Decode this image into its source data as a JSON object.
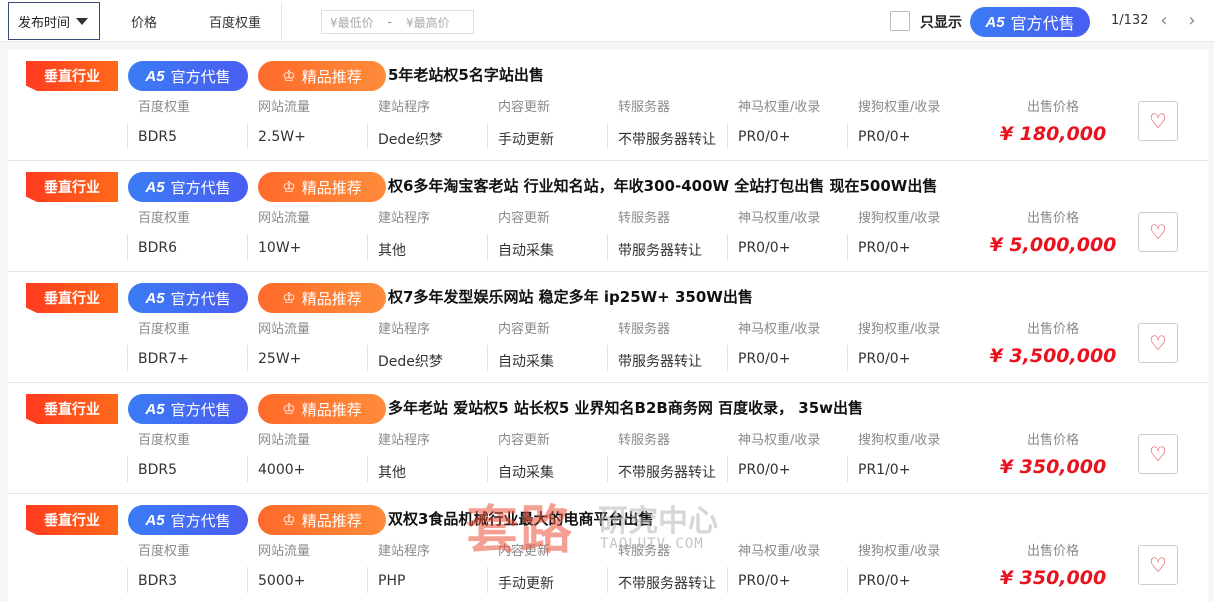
{
  "toolbar": {
    "sort_label": "发布时间",
    "price_label": "价格",
    "baidu_weight_label": "百度权重",
    "min_price_placeholder": "¥最低价",
    "dash": "-",
    "max_price_placeholder": "¥最高价",
    "only_show_label": "只显示",
    "a5_label": "官方代售",
    "page_info": "1/132",
    "prev": "‹",
    "next": "›"
  },
  "tags": {
    "vertical": "垂直行业",
    "a5_logo": "A5",
    "a5_text": "官方代售",
    "premium": "精品推荐"
  },
  "columns": [
    "百度权重",
    "网站流量",
    "建站程序",
    "内容更新",
    "转服务器",
    "神马权重/收录",
    "搜狗权重/收录"
  ],
  "price_label": "出售价格",
  "listings": [
    {
      "title": "5年老站权5名字站出售",
      "values": [
        "BDR5",
        "2.5W+",
        "Dede织梦",
        "手动更新",
        "不带服务器转让",
        "PR0/0+",
        "PR0/0+"
      ],
      "price": "¥ 180,000"
    },
    {
      "title": "权6多年淘宝客老站 行业知名站，年收300-400W 全站打包出售 现在500W出售",
      "values": [
        "BDR6",
        "10W+",
        "其他",
        "自动采集",
        "带服务器转让",
        "PR0/0+",
        "PR0/0+"
      ],
      "price": "¥ 5,000,000"
    },
    {
      "title": "权7多年发型娱乐网站 稳定多年 ip25W+ 350W出售",
      "values": [
        "BDR7+",
        "25W+",
        "Dede织梦",
        "自动采集",
        "带服务器转让",
        "PR0/0+",
        "PR0/0+"
      ],
      "price": "¥ 3,500,000"
    },
    {
      "title": "多年老站 爱站权5 站长权5 业界知名B2B商务网 百度收录， 35w出售",
      "values": [
        "BDR5",
        "4000+",
        "其他",
        "自动采集",
        "不带服务器转让",
        "PR0/0+",
        "PR1/0+"
      ],
      "price": "¥ 350,000"
    },
    {
      "title": "双权3食品机械行业最大的电商平台出售",
      "values": [
        "BDR3",
        "5000+",
        "PHP",
        "手动更新",
        "不带服务器转让",
        "PR0/0+",
        "PR0/0+"
      ],
      "price": "¥ 350,000"
    }
  ],
  "watermark": {
    "big": "套路",
    "mid": "研究中心",
    "url": "TAOLUTV.COM"
  }
}
